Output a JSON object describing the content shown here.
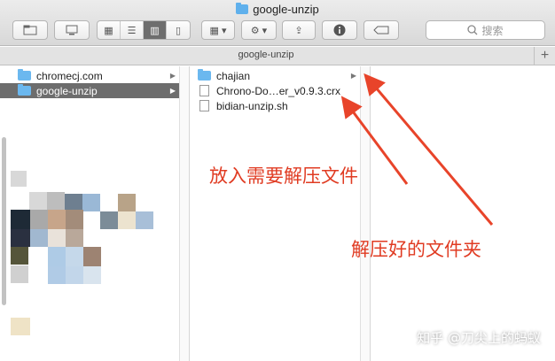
{
  "window": {
    "title": "google-unzip"
  },
  "toolbar": {
    "search_placeholder": "搜索"
  },
  "pathbar": {
    "label": "google-unzip"
  },
  "column1": {
    "items": [
      {
        "label": "chromecj.com",
        "type": "folder"
      },
      {
        "label": "google-unzip",
        "type": "folder",
        "selected": true
      }
    ]
  },
  "column2": {
    "items": [
      {
        "label": "chajian",
        "type": "folder"
      },
      {
        "label": "Chrono-Do…er_v0.9.3.crx",
        "type": "file"
      },
      {
        "label": "bidian-unzip.sh",
        "type": "file"
      }
    ]
  },
  "annotations": {
    "put_files": "放入需要解压文件",
    "unzipped_folder": "解压好的文件夹"
  },
  "watermark": "知乎 @刀尖上的蚂蚁",
  "colors": {
    "accent": "#e03b22",
    "selection": "#6d6d6d",
    "folder": "#6bb8ef"
  }
}
